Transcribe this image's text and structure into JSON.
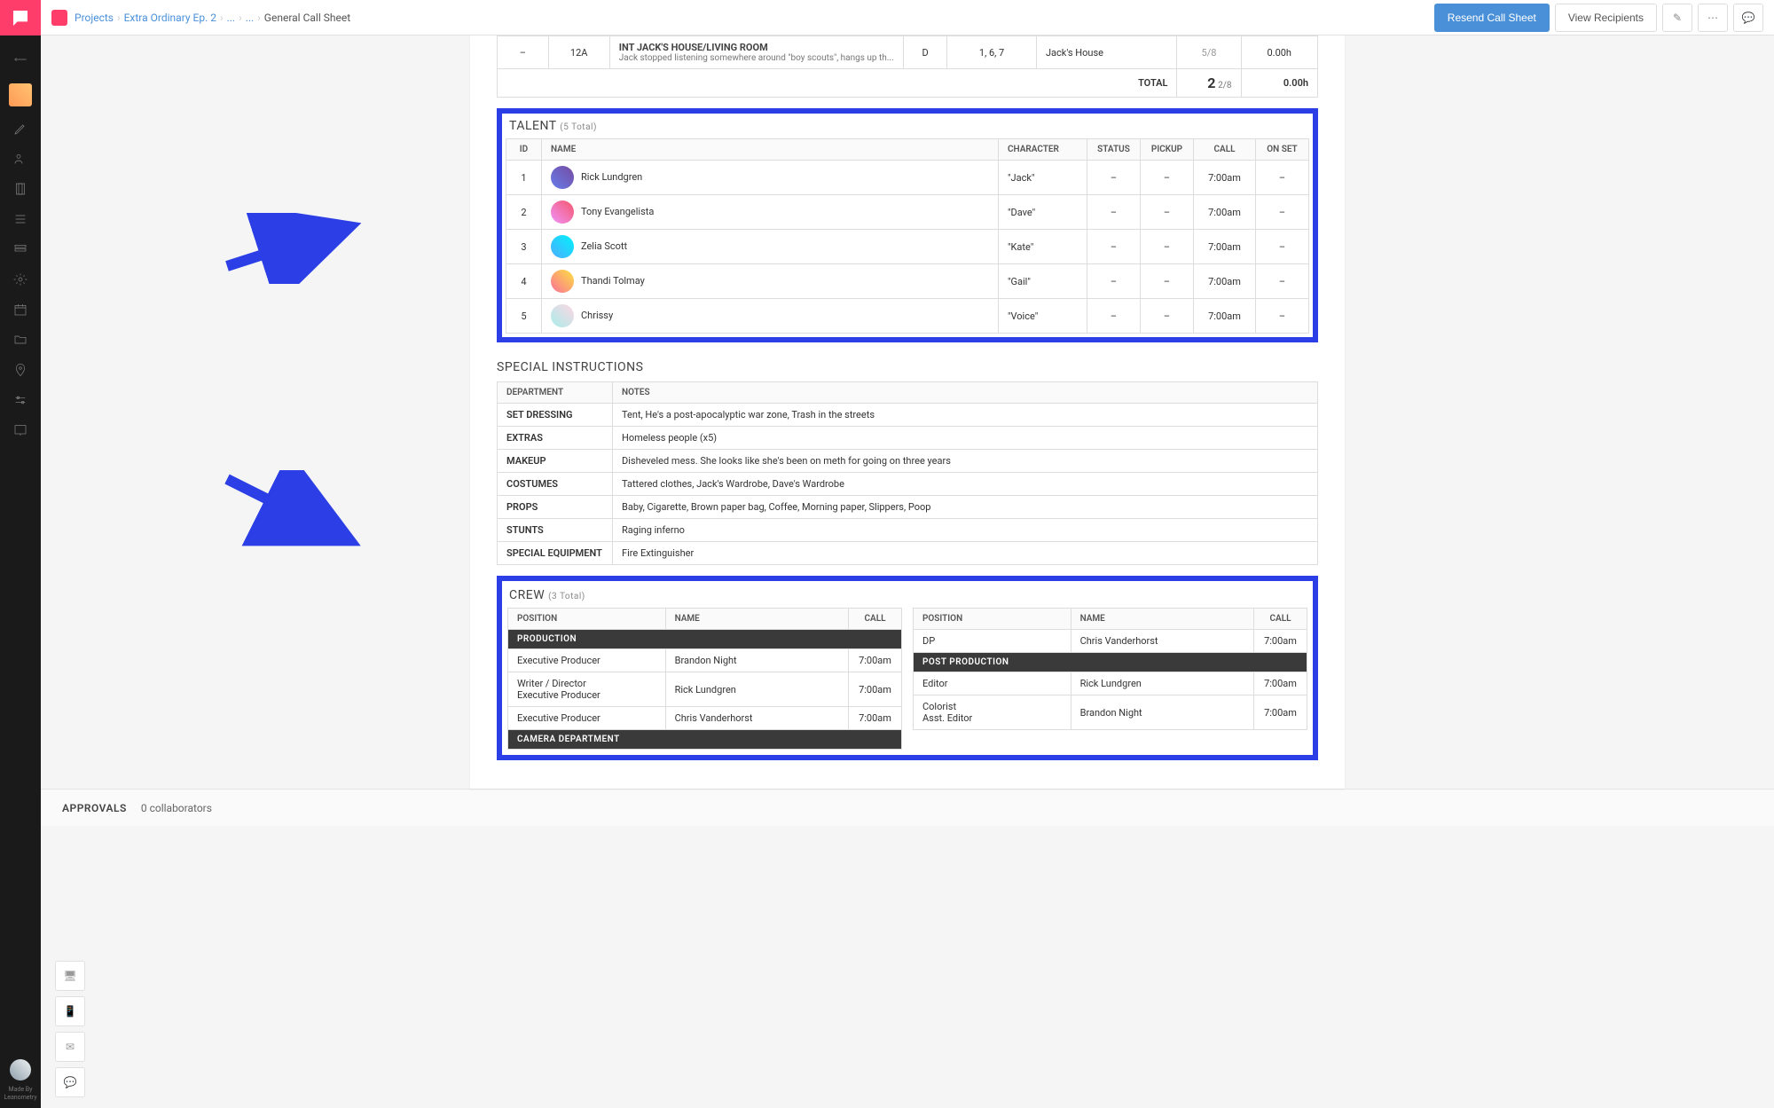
{
  "header": {
    "breadcrumb": {
      "projects": "Projects",
      "project_name": "Extra Ordinary Ep. 2",
      "dots": "...",
      "dots2": "...",
      "current": "General Call Sheet"
    },
    "actions": {
      "resend": "Resend Call Sheet",
      "view_recipients": "View Recipients"
    }
  },
  "scene_tail": {
    "row": {
      "dash1": "–",
      "scene_no": "12A",
      "heading": "INT JACK'S HOUSE/LIVING ROOM",
      "desc": "Jack stopped listening somewhere around \"boy scouts\", hangs up th...",
      "dn": "D",
      "cast": "1, 6, 7",
      "location": "Jack's House",
      "pages": "5/8",
      "time": "0.00h"
    },
    "total": {
      "label": "TOTAL",
      "pages_big": "2",
      "pages_frac": "2/8",
      "time": "0.00h"
    }
  },
  "talent": {
    "title": "TALENT",
    "count_label": "(5 Total)",
    "headers": {
      "id": "ID",
      "name": "NAME",
      "character": "CHARACTER",
      "status": "STATUS",
      "pickup": "PICKUP",
      "call": "CALL",
      "onset": "ON SET"
    },
    "rows": [
      {
        "id": "1",
        "name": "Rick Lundgren",
        "character": "\"Jack\"",
        "status": "–",
        "pickup": "–",
        "call": "7:00am",
        "onset": "–"
      },
      {
        "id": "2",
        "name": "Tony Evangelista",
        "character": "\"Dave\"",
        "status": "–",
        "pickup": "–",
        "call": "7:00am",
        "onset": "–"
      },
      {
        "id": "3",
        "name": "Zelia Scott",
        "character": "\"Kate\"",
        "status": "–",
        "pickup": "–",
        "call": "7:00am",
        "onset": "–"
      },
      {
        "id": "4",
        "name": "Thandi Tolmay",
        "character": "\"Gail\"",
        "status": "–",
        "pickup": "–",
        "call": "7:00am",
        "onset": "–"
      },
      {
        "id": "5",
        "name": "Chrissy",
        "character": "\"Voice\"",
        "status": "–",
        "pickup": "–",
        "call": "7:00am",
        "onset": "–"
      }
    ]
  },
  "special": {
    "title": "SPECIAL INSTRUCTIONS",
    "headers": {
      "dept": "DEPARTMENT",
      "notes": "NOTES"
    },
    "rows": [
      {
        "dept": "SET DRESSING",
        "notes": "Tent, He's a post-apocalyptic war zone, Trash in the streets"
      },
      {
        "dept": "EXTRAS",
        "notes": "Homeless people (x5)"
      },
      {
        "dept": "MAKEUP",
        "notes": "Disheveled mess. She looks like she's been on meth for going on three years"
      },
      {
        "dept": "COSTUMES",
        "notes": "Tattered clothes, Jack's Wardrobe, Dave's Wardrobe"
      },
      {
        "dept": "PROPS",
        "notes": "Baby, Cigarette, Brown paper bag, Coffee, Morning paper, Slippers, Poop"
      },
      {
        "dept": "STUNTS",
        "notes": "Raging inferno"
      },
      {
        "dept": "SPECIAL EQUIPMENT",
        "notes": "Fire Extinguisher"
      }
    ]
  },
  "crew": {
    "title": "CREW",
    "count_label": "(3 Total)",
    "headers": {
      "position": "POSITION",
      "name": "NAME",
      "call": "CALL"
    },
    "left": {
      "dept1": "PRODUCTION",
      "rows1": [
        {
          "position": "Executive Producer",
          "name": "Brandon Night",
          "call": "7:00am"
        },
        {
          "position": "Writer / Director\nExecutive Producer",
          "name": "Rick Lundgren",
          "call": "7:00am"
        },
        {
          "position": "Executive Producer",
          "name": "Chris Vanderhorst",
          "call": "7:00am"
        }
      ],
      "dept2": "CAMERA DEPARTMENT"
    },
    "right": {
      "rows0": [
        {
          "position": "DP",
          "name": "Chris Vanderhorst",
          "call": "7:00am"
        }
      ],
      "dept1": "POST PRODUCTION",
      "rows1": [
        {
          "position": "Editor",
          "name": "Rick Lundgren",
          "call": "7:00am"
        },
        {
          "position": "Colorist\nAsst. Editor",
          "name": "Brandon Night",
          "call": "7:00am"
        }
      ]
    }
  },
  "approvals": {
    "label": "APPROVALS",
    "collab": "0 collaborators"
  },
  "made_by": {
    "line1": "Made By",
    "line2": "Leanometry"
  }
}
